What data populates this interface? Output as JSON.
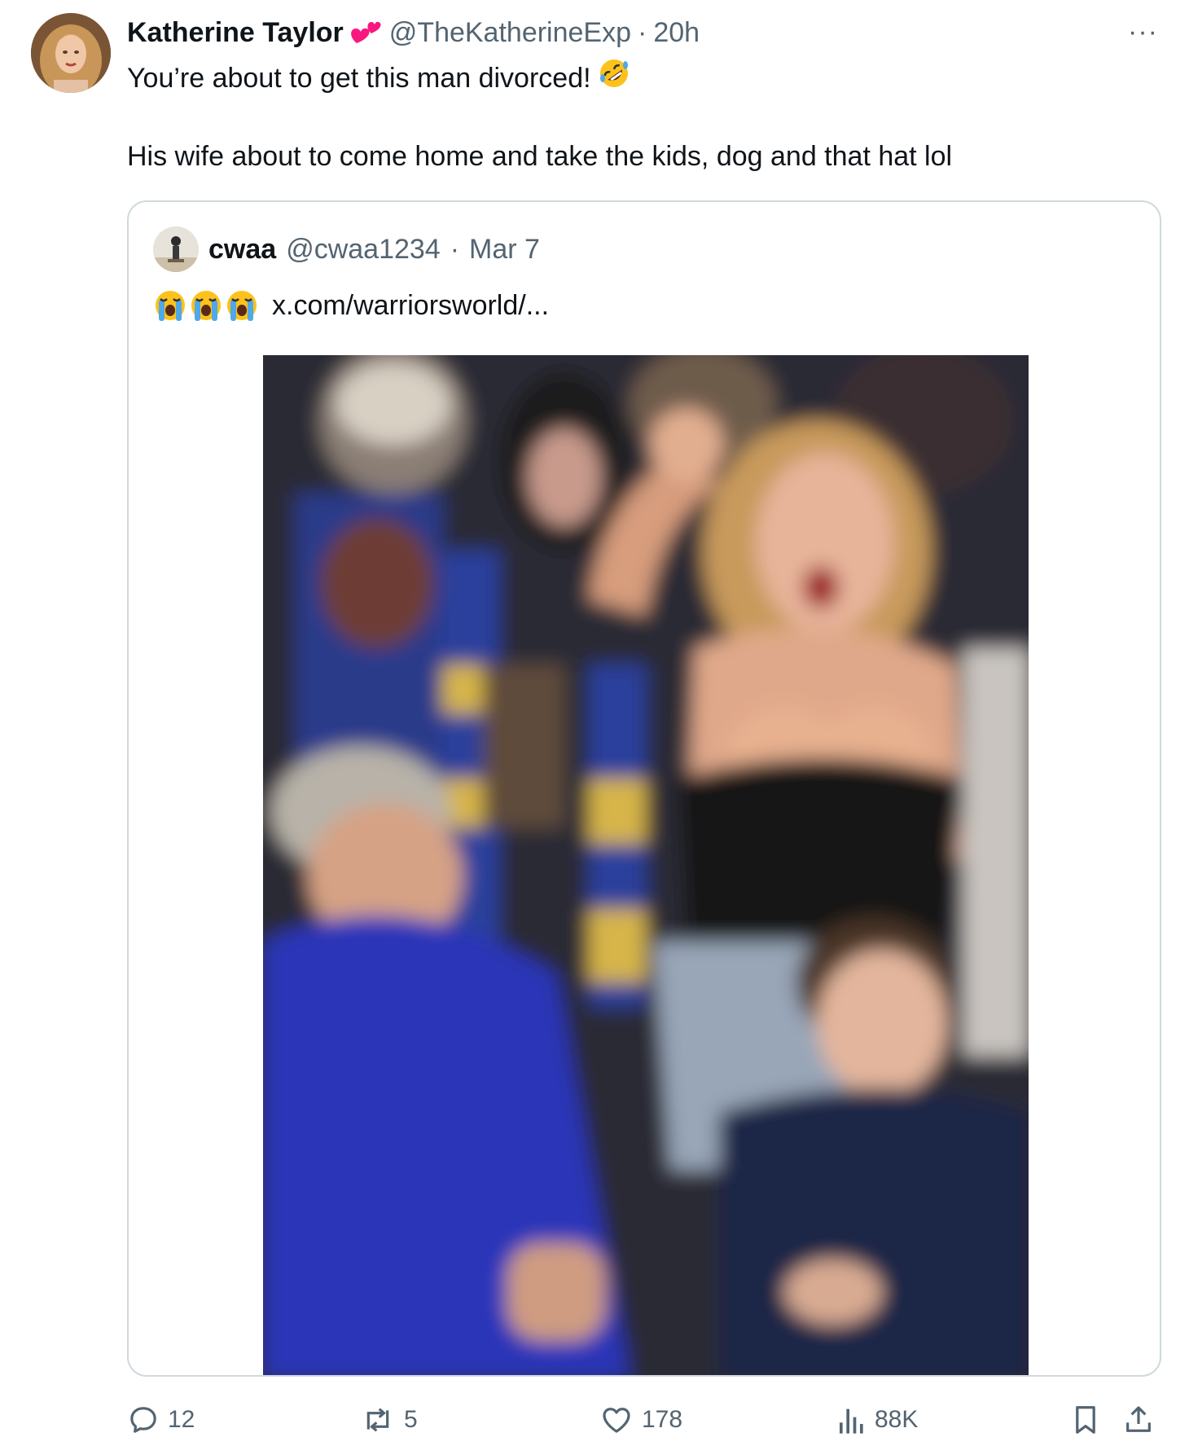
{
  "tweet": {
    "author_name": "Katherine Taylor",
    "author_emoji": "two-hearts-emoji",
    "handle": "@TheKatherineExp",
    "separator": "·",
    "time": "20h",
    "more_label": "···",
    "line1": "You’re about to get this man divorced!",
    "line1_emoji": "rofl-emoji",
    "line2": "His wife about to come home and take the kids, dog and that hat lol"
  },
  "quote": {
    "author_name": "cwaa",
    "handle": "@cwaa1234",
    "separator": "·",
    "date": "Mar 7",
    "emoji": "loudly-crying-face-emoji",
    "link": "x.com/warriorsworld/...",
    "media": "blurred-crowd-photo"
  },
  "actions": {
    "replies": "12",
    "reposts": "5",
    "likes": "178",
    "views": "88K"
  },
  "colors": {
    "text": "#0f1419",
    "muted": "#536471",
    "border": "#cfd9de",
    "heart_pink": "#f91880"
  }
}
